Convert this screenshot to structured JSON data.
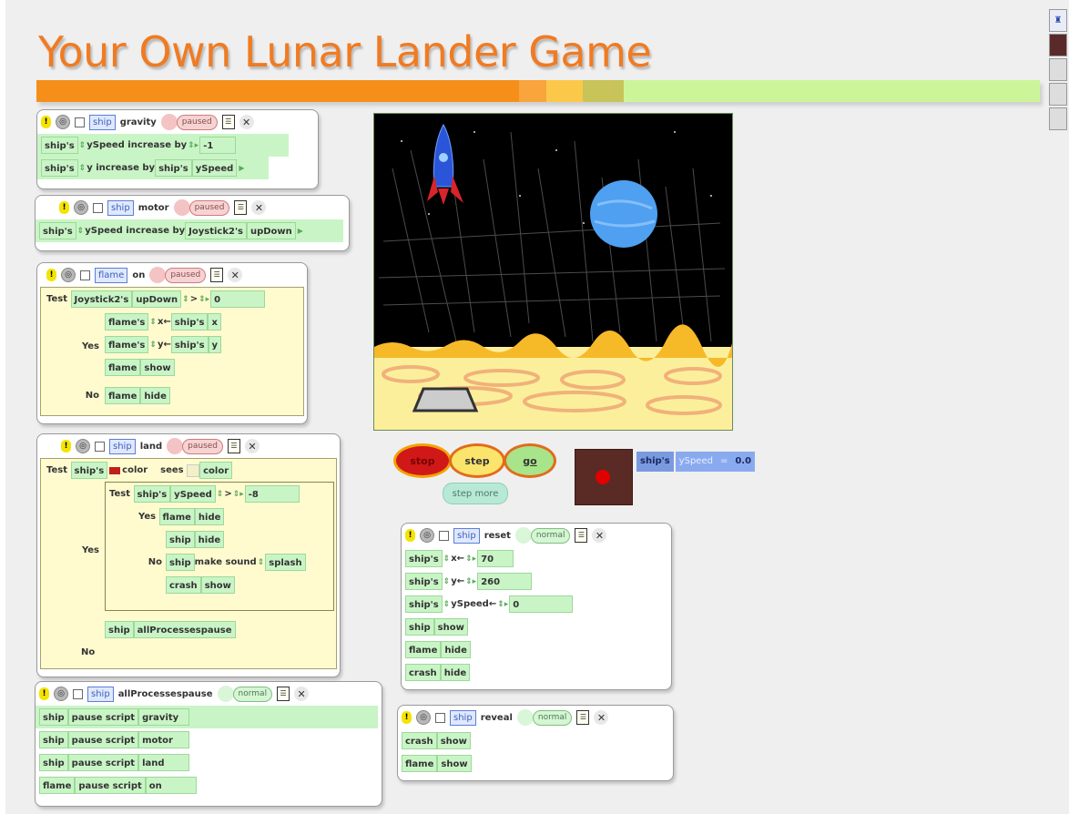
{
  "title": "Your Own Lunar Lander Game",
  "band_colors": [
    "#f58f1a",
    "#f9a43c",
    "#fbc84a",
    "#c8c45a",
    "#ccf59a"
  ],
  "toolbar_icons": [
    "bug-icon",
    "record-icon",
    "tool-icon",
    "tool-icon",
    "tool-icon"
  ],
  "controls": {
    "stop": "stop",
    "step": "step",
    "go": "go",
    "step_more": "step more"
  },
  "watcher": {
    "object": "ship's",
    "label": "ySpeed",
    "op": "=",
    "value": "0.0"
  },
  "scripts": {
    "gravity": {
      "object": "ship",
      "name": "gravity",
      "status": "paused",
      "rows": [
        {
          "t": "ship's",
          "p": "ySpeed increase by",
          "v": "-1"
        },
        {
          "t": "ship's",
          "p": "y increase by",
          "a": "ship's",
          "b": "ySpeed"
        }
      ]
    },
    "motor": {
      "object": "ship",
      "name": "motor",
      "status": "paused",
      "rows": [
        {
          "t": "ship's",
          "p": "ySpeed increase by",
          "a": "Joystick2's",
          "b": "upDown"
        }
      ]
    },
    "flame_on": {
      "object": "flame",
      "name": "on",
      "status": "paused",
      "test": {
        "label": "Test",
        "a": "Joystick2's",
        "b": "upDown",
        "op": ">",
        "v": "0"
      },
      "yes_label": "Yes",
      "no_label": "No",
      "yes": [
        {
          "t": "flame's",
          "p": "x",
          "a": "ship's",
          "b": "x"
        },
        {
          "t": "flame's",
          "p": "y",
          "a": "ship's",
          "b": "y"
        },
        {
          "t": "flame",
          "p": "show"
        }
      ],
      "no": [
        {
          "t": "flame",
          "p": "hide"
        }
      ]
    },
    "land": {
      "object": "ship",
      "name": "land",
      "status": "paused",
      "test": {
        "label": "Test",
        "a": "ship's",
        "b": "color",
        "sees": "sees",
        "c": "color"
      },
      "inner_test": {
        "label": "Test",
        "a": "ship's",
        "b": "ySpeed",
        "op": ">",
        "v": "-8"
      },
      "yes_label": "Yes",
      "no_label": "No",
      "inner_yes": [
        {
          "t": "flame",
          "p": "hide"
        }
      ],
      "inner_no": [
        {
          "t": "ship",
          "p": "hide"
        },
        {
          "t": "ship",
          "p": "make sound",
          "v": "splash"
        },
        {
          "t": "crash",
          "p": "show"
        }
      ],
      "after": {
        "t": "ship",
        "p": "allProcessespause"
      }
    },
    "allpause": {
      "object": "ship",
      "name": "allProcessespause",
      "status": "normal",
      "rows": [
        {
          "t": "ship",
          "p": "pause script",
          "v": "gravity"
        },
        {
          "t": "ship",
          "p": "pause script",
          "v": "motor"
        },
        {
          "t": "ship",
          "p": "pause script",
          "v": "land"
        },
        {
          "t": "flame",
          "p": "pause script",
          "v": "on"
        }
      ]
    },
    "reset": {
      "object": "ship",
      "name": "reset",
      "status": "normal",
      "rows": [
        {
          "t": "ship's",
          "p": "x",
          "v": "70"
        },
        {
          "t": "ship's",
          "p": "y",
          "v": "260"
        },
        {
          "t": "ship's",
          "p": "ySpeed",
          "v": "0"
        },
        {
          "t": "ship",
          "p": "show"
        },
        {
          "t": "flame",
          "p": "hide"
        },
        {
          "t": "crash",
          "p": "hide"
        }
      ]
    },
    "reveal": {
      "object": "ship",
      "name": "reveal",
      "status": "normal",
      "rows": [
        {
          "t": "crash",
          "p": "show"
        },
        {
          "t": "flame",
          "p": "show"
        }
      ]
    }
  }
}
